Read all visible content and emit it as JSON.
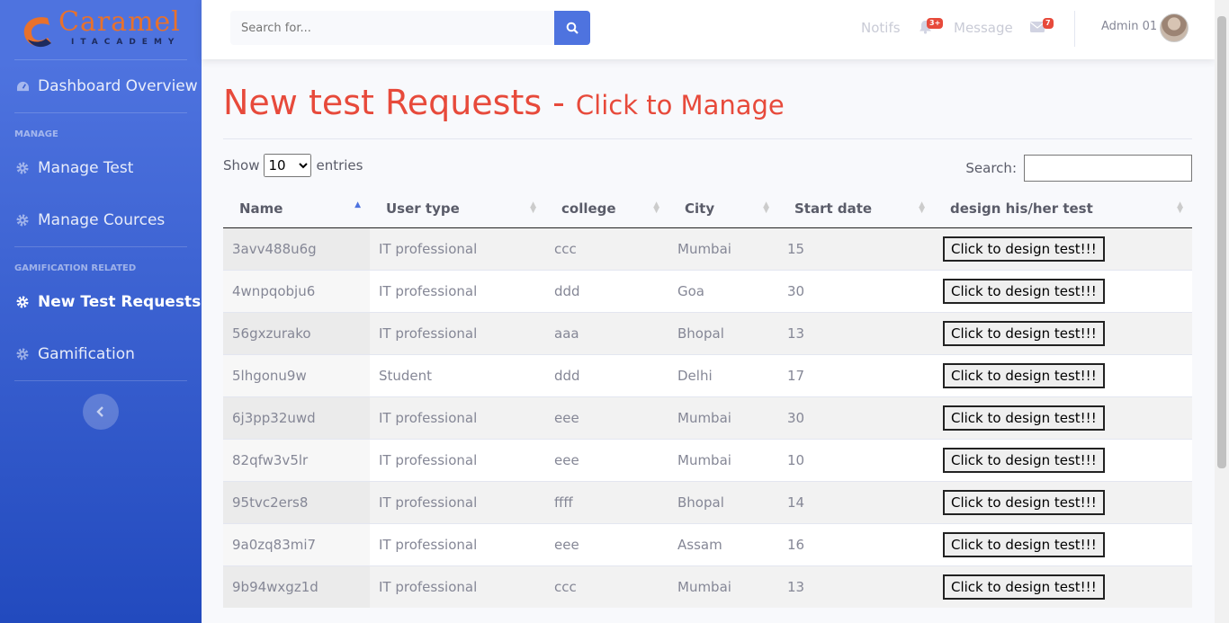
{
  "brand": {
    "name": "Caramel",
    "tagline": "ITACADEMY"
  },
  "sidebar": {
    "dashboard": "Dashboard Overview",
    "heading_manage": "MANAGE",
    "manage_test": "Manage Test",
    "manage_cources": "Manage Cources",
    "heading_gamification": "GAMIFICATION RELATED",
    "new_test_requests": "New Test Requests",
    "gamification": "Gamification"
  },
  "topbar": {
    "search_placeholder": "Search for...",
    "notifs_label": "Notifs",
    "notifs_badge": "3+",
    "message_label": "Message",
    "message_badge": "7",
    "user_name": "Admin 01"
  },
  "page": {
    "title": "New test Requests",
    "separator": "-",
    "subtitle": "Click to Manage"
  },
  "table_controls": {
    "show_label": "Show",
    "entries_value": "10",
    "entries_label": "entries",
    "search_label": "Search:"
  },
  "table": {
    "headers": [
      "Name",
      "User type",
      "college",
      "City",
      "Start date",
      "design his/her test"
    ],
    "button_label": "Click to design test!!!",
    "rows": [
      [
        "3avv488u6g",
        "IT professional",
        "ccc",
        "Mumbai",
        "15"
      ],
      [
        "4wnpqobju6",
        "IT professional",
        "ddd",
        "Goa",
        "30"
      ],
      [
        "56gxzurako",
        "IT professional",
        "aaa",
        "Bhopal",
        "13"
      ],
      [
        "5lhgonu9w",
        "Student",
        "ddd",
        "Delhi",
        "17"
      ],
      [
        "6j3pp32uwd",
        "IT professional",
        "eee",
        "Mumbai",
        "30"
      ],
      [
        "82qfw3v5lr",
        "IT professional",
        "eee",
        "Mumbai",
        "10"
      ],
      [
        "95tvc2ers8",
        "IT professional",
        "ffff",
        "Bhopal",
        "14"
      ],
      [
        "9a0zq83mi7",
        "IT professional",
        "eee",
        "Assam",
        "16"
      ],
      [
        "9b94wxgz1d",
        "IT professional",
        "ccc",
        "Mumbai",
        "13"
      ]
    ]
  },
  "colors": {
    "sidebar": "#4e73df",
    "accent_red": "#e74a3b",
    "primary": "#4e73df"
  }
}
